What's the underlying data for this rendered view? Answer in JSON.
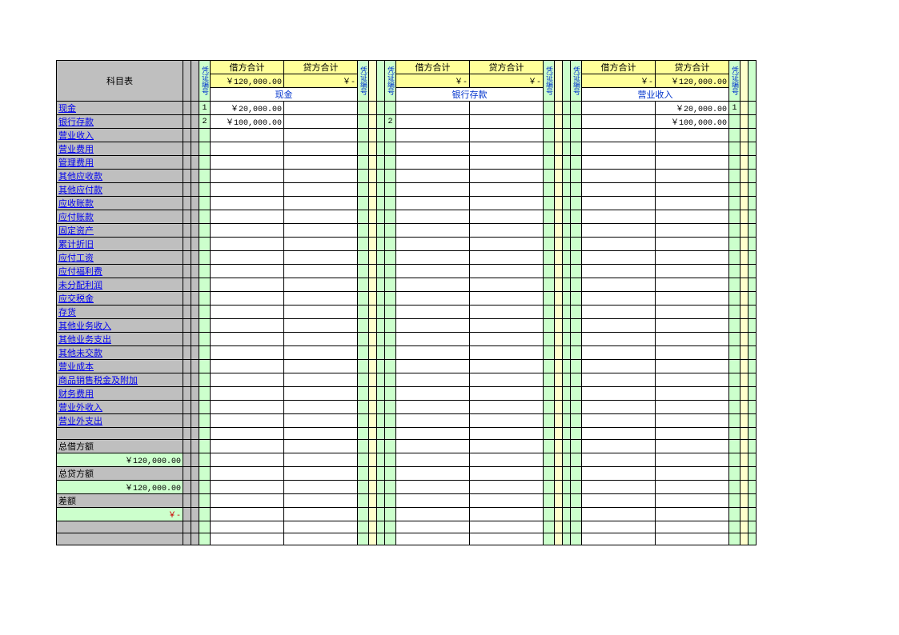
{
  "header": {
    "account_table": "科目表",
    "debit_total": "借方合计",
    "credit_total": "贷方合计",
    "voucher_no": "凭证编号"
  },
  "sections": [
    {
      "name": "现金",
      "debit": "￥120,000.00",
      "credit": "￥-"
    },
    {
      "name": "银行存款",
      "debit": "￥-",
      "credit": "￥-"
    },
    {
      "name": "营业收入",
      "debit": "￥-",
      "credit": "￥120,000.00"
    }
  ],
  "accounts": [
    "现金",
    "银行存款",
    "营业收入",
    "营业费用",
    "管理费用",
    "其他应收款",
    "其他应付款",
    "应收账款",
    "应付账款",
    "固定资产",
    "累计折旧",
    "应付工资",
    "应付福利费",
    "未分配利润",
    "应交税金",
    "存货",
    "其他业务收入",
    "其他业务支出",
    "其他未交款",
    "营业成本",
    "商品销售税金及附加",
    "财务费用",
    "营业外收入",
    "营业外支出"
  ],
  "footer": {
    "total_debit_label": "总借方额",
    "total_debit": "￥120,000.00",
    "total_credit_label": "总贷方额",
    "total_credit": "￥120,000.00",
    "diff_label": "差额",
    "diff": "￥-"
  },
  "rows": [
    {
      "acct_idx": 0,
      "s0_vno": "1",
      "s0_debit": "￥20,000.00",
      "s2_credit": "￥20,000.00",
      "s2_vno_r": "1"
    },
    {
      "acct_idx": 1,
      "s0_vno": "2",
      "s0_debit": "￥100,000.00",
      "s1_vno": "2",
      "s2_credit": "￥100,000.00"
    }
  ]
}
